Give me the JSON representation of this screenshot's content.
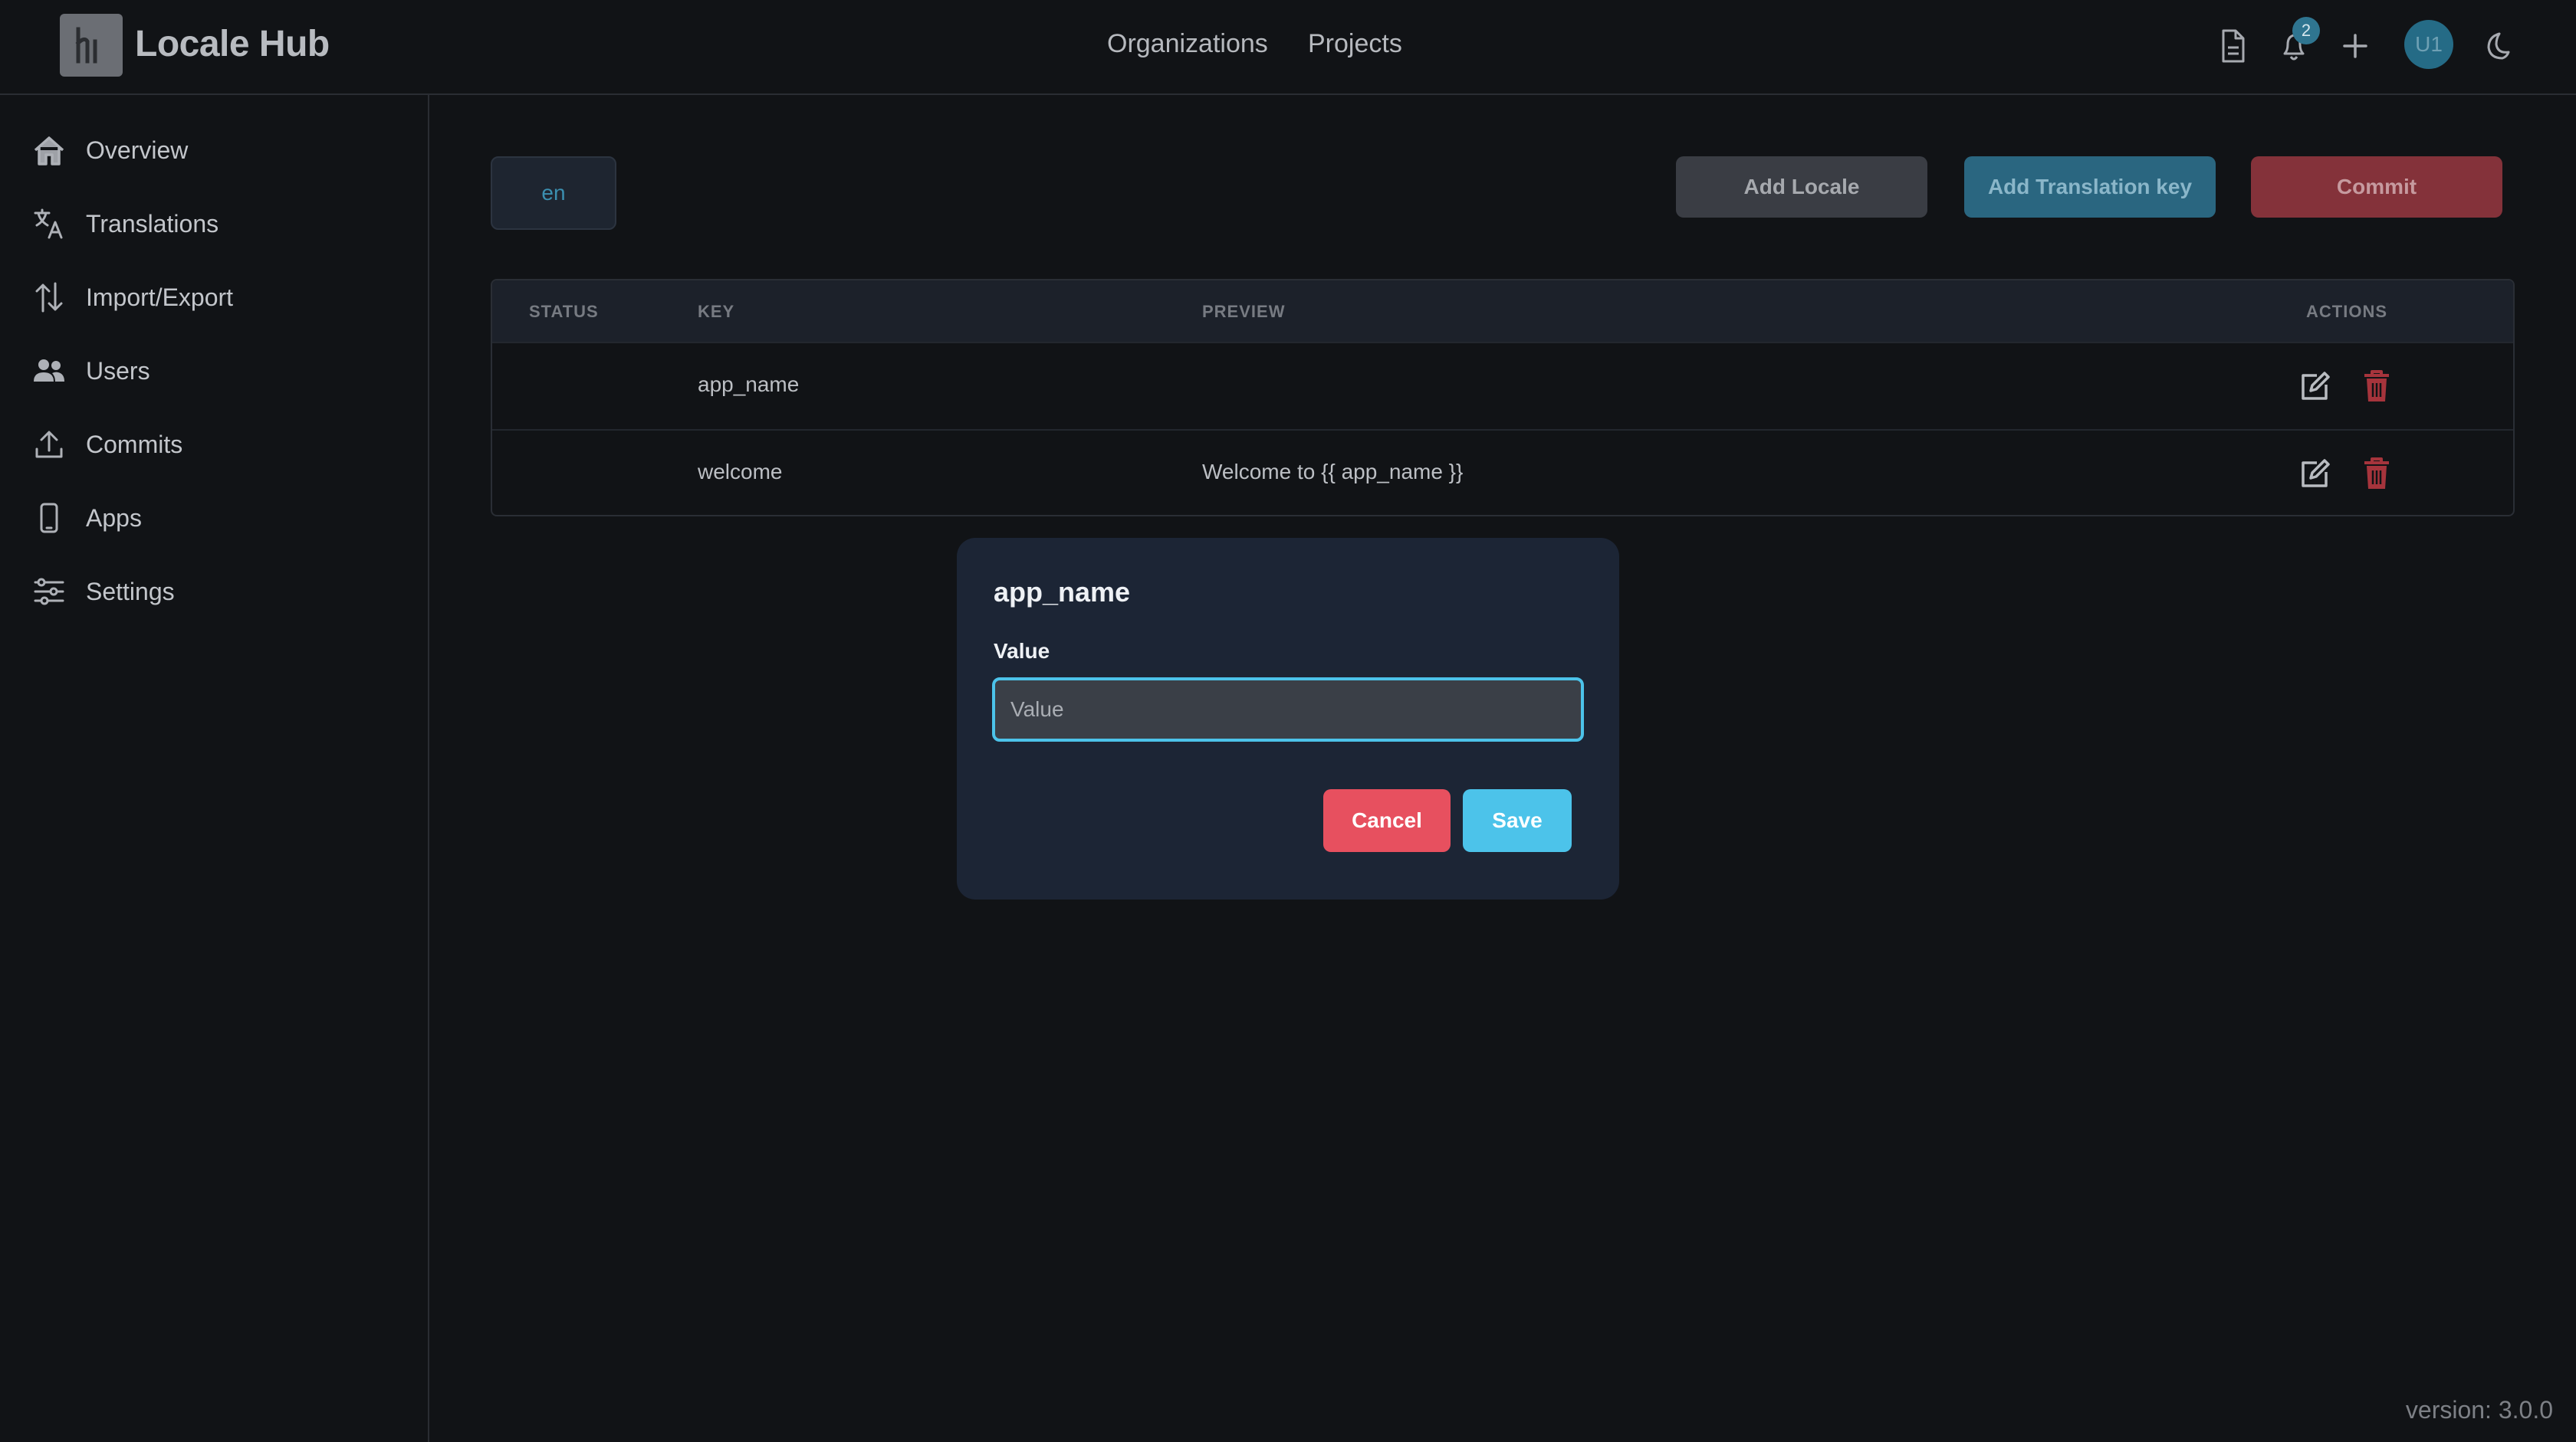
{
  "header": {
    "app_title": "Locale Hub",
    "nav": [
      "Organizations",
      "Projects"
    ],
    "notification_count": "2",
    "avatar_initials": "U1"
  },
  "sidebar": {
    "items": [
      {
        "label": "Overview",
        "icon": "home-icon"
      },
      {
        "label": "Translations",
        "icon": "translate-icon"
      },
      {
        "label": "Import/Export",
        "icon": "import-export-icon"
      },
      {
        "label": "Users",
        "icon": "users-icon"
      },
      {
        "label": "Commits",
        "icon": "upload-icon"
      },
      {
        "label": "Apps",
        "icon": "mobile-icon"
      },
      {
        "label": "Settings",
        "icon": "sliders-icon"
      }
    ]
  },
  "toolbar": {
    "locale": "en",
    "add_locale": "Add Locale",
    "add_key": "Add Translation key",
    "commit": "Commit"
  },
  "table": {
    "headers": {
      "status": "STATUS",
      "key": "KEY",
      "preview": "PREVIEW",
      "actions": "ACTIONS"
    },
    "rows": [
      {
        "status": "",
        "key": "app_name",
        "preview": ""
      },
      {
        "status": "",
        "key": "welcome",
        "preview": "Welcome to {{ app_name }}"
      }
    ]
  },
  "modal": {
    "title": "app_name",
    "label": "Value",
    "placeholder": "Value",
    "value": "",
    "cancel": "Cancel",
    "save": "Save"
  },
  "footer": {
    "version": "version: 3.0.0"
  },
  "colors": {
    "background": "#111316",
    "accent": "#4cc3ea",
    "danger": "#e7505f",
    "modal_bg": "#1c2535"
  }
}
